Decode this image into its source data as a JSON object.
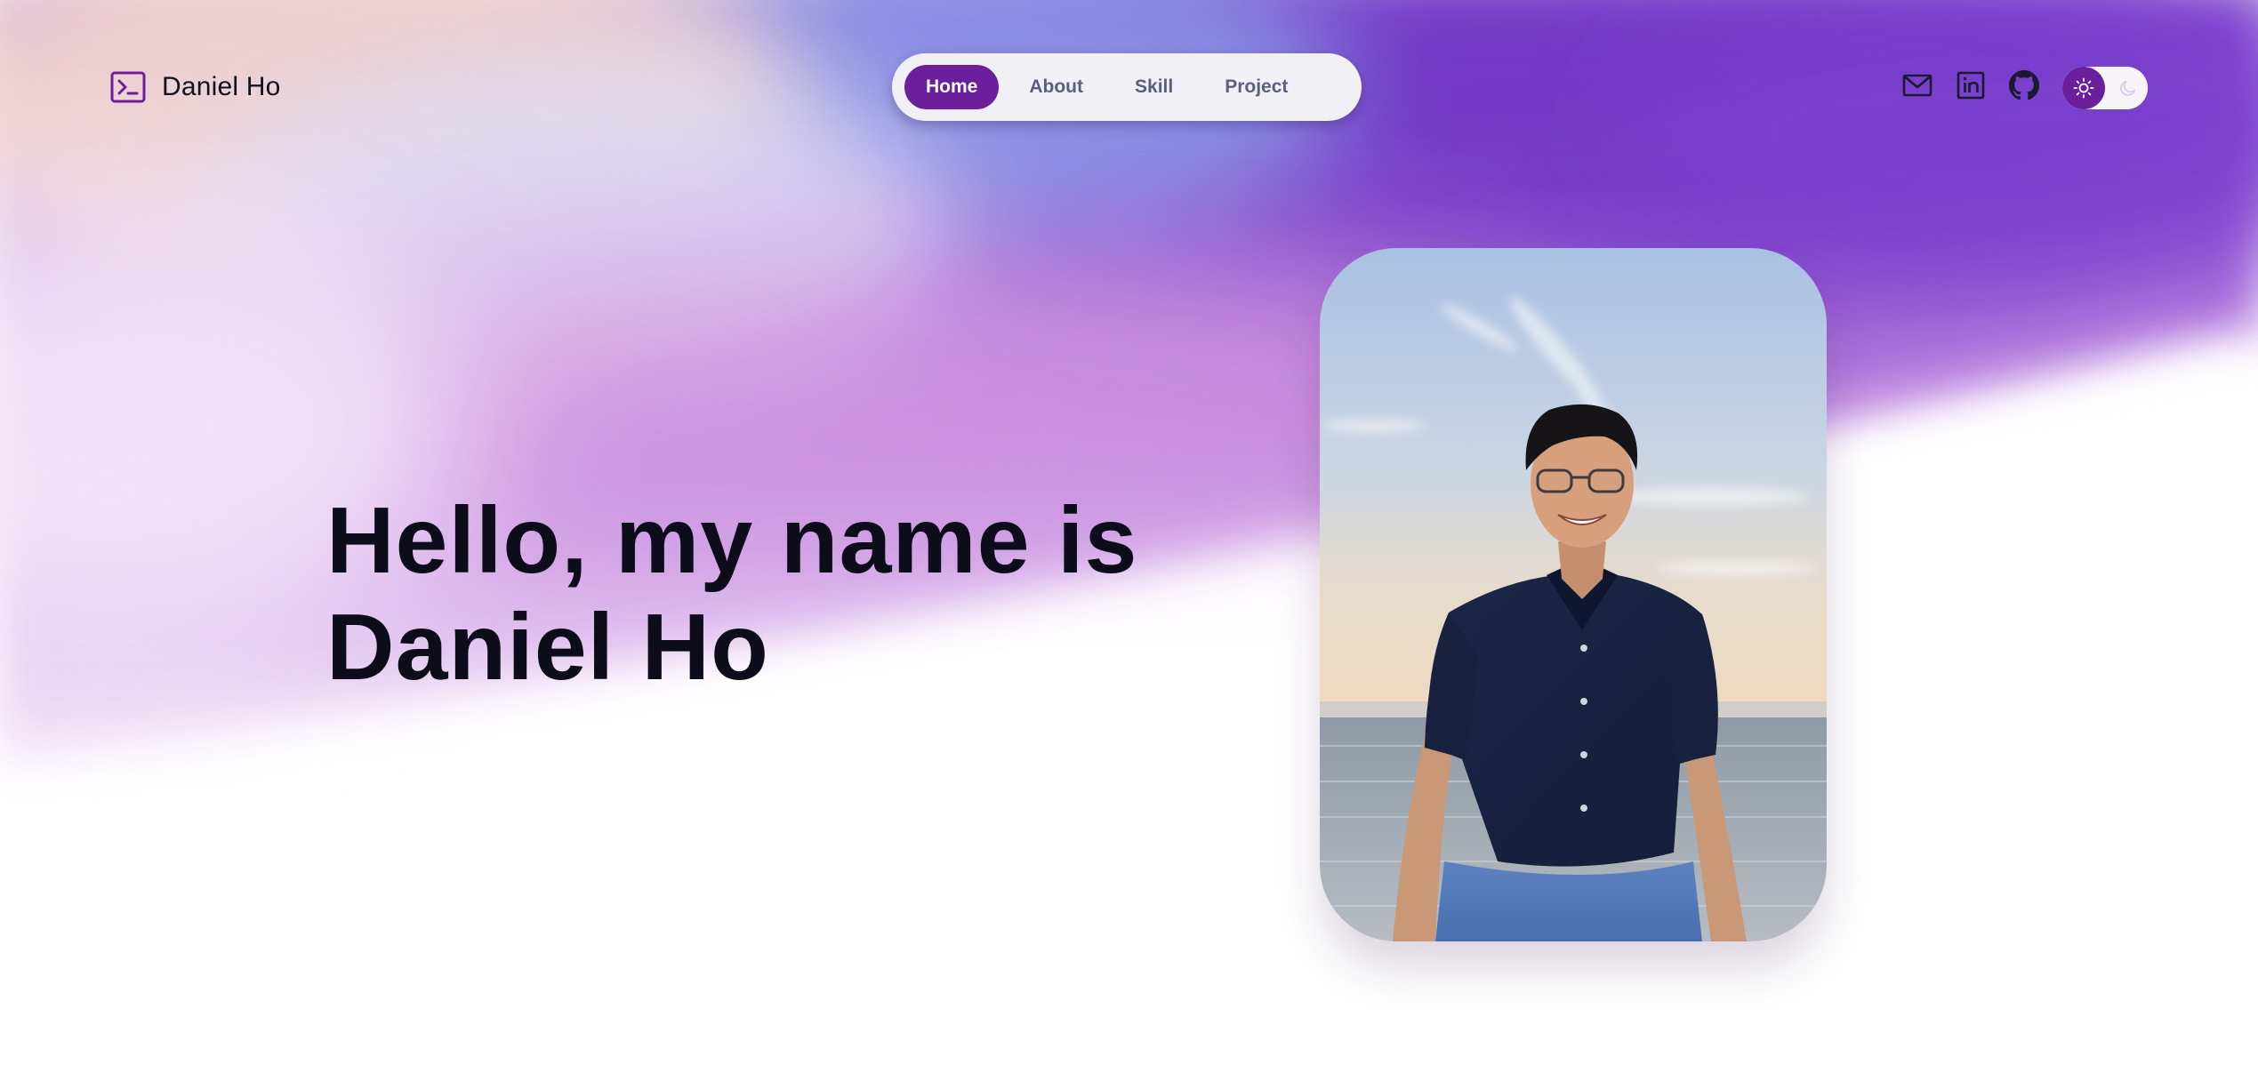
{
  "header": {
    "logo": {
      "icon": "terminal-icon",
      "name": "Daniel Ho"
    },
    "nav": [
      {
        "label": "Home",
        "active": true
      },
      {
        "label": "About",
        "active": false
      },
      {
        "label": "Skill",
        "active": false
      },
      {
        "label": "Project",
        "active": false
      }
    ],
    "socials": [
      {
        "icon": "mail-icon"
      },
      {
        "icon": "linkedin-icon"
      },
      {
        "icon": "github-icon"
      }
    ],
    "theme_toggle": {
      "mode": "light",
      "icons": [
        "sun-icon",
        "moon-icon"
      ]
    }
  },
  "hero": {
    "title_line1": "Hello, my name is",
    "title_line2": "Daniel Ho",
    "photo": {
      "alt_icon": "profile-photo"
    }
  },
  "colors": {
    "accent": "#6b1f9c",
    "text_dark": "#0c0c1a",
    "nav_text": "#5a5f7a",
    "nav_bg": "#f1f1f5",
    "gradient_violet": "#7d3ed0",
    "gradient_pink": "#c77ad6",
    "gradient_blue": "#8a9be6",
    "gradient_peach": "#f0c8b8"
  }
}
